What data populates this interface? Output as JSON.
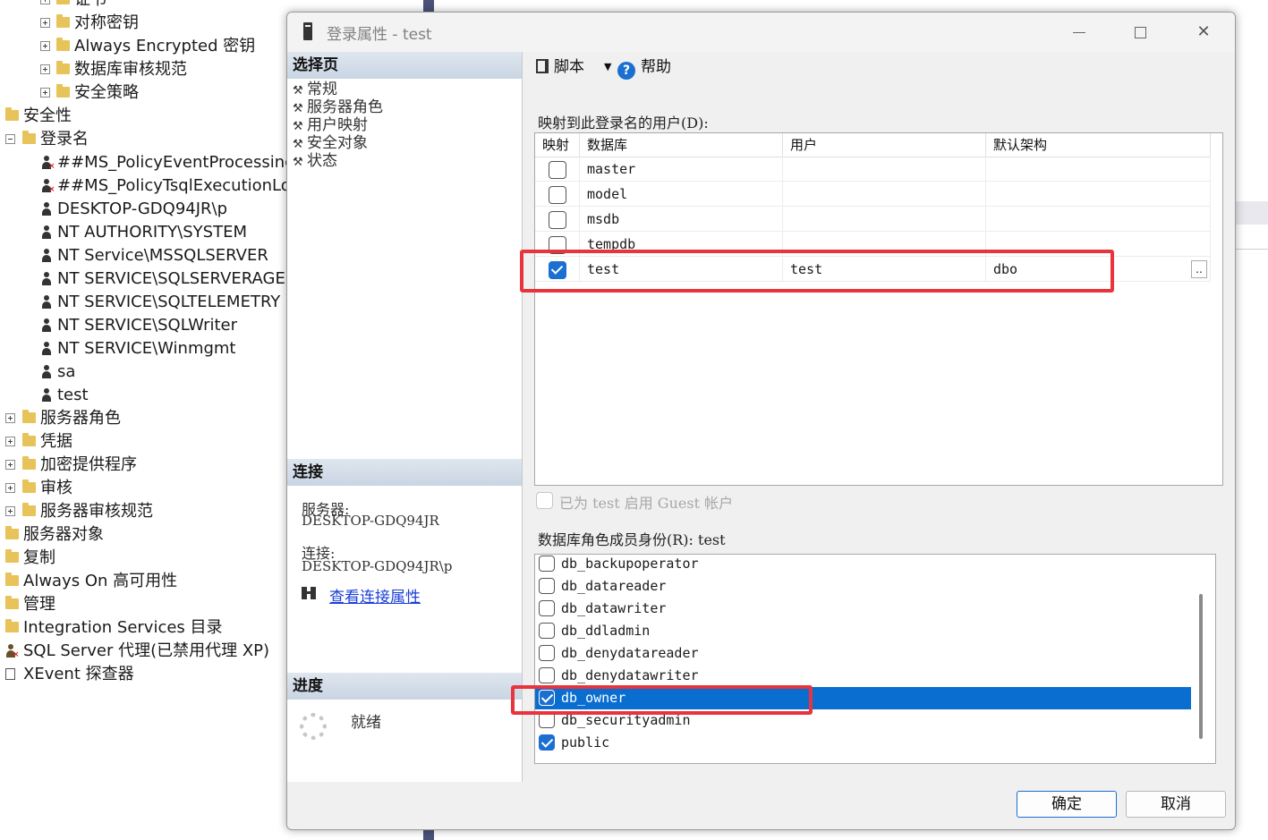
{
  "tree": {
    "items": [
      {
        "label": "证书",
        "depth": 2,
        "icon": "folder-icon",
        "expander": "plus"
      },
      {
        "label": "对称密钥",
        "depth": 2,
        "icon": "folder-icon",
        "expander": "plus"
      },
      {
        "label": "Always Encrypted 密钥",
        "depth": 2,
        "icon": "folder-icon",
        "expander": "plus"
      },
      {
        "label": "数据库审核规范",
        "depth": 2,
        "icon": "folder-icon",
        "expander": "plus"
      },
      {
        "label": "安全策略",
        "depth": 2,
        "icon": "folder-icon",
        "expander": "plus"
      },
      {
        "label": "安全性",
        "depth": 0,
        "icon": "folder-icon",
        "expander": "none"
      },
      {
        "label": "登录名",
        "depth": 1,
        "icon": "folder-icon",
        "expander": "minus"
      },
      {
        "label": "##MS_PolicyEventProcessingLogin##",
        "depth": 2,
        "icon": "login-disabled-icon",
        "expander": "none"
      },
      {
        "label": "##MS_PolicyTsqlExecutionLogin##",
        "depth": 2,
        "icon": "login-disabled-icon",
        "expander": "none"
      },
      {
        "label": "DESKTOP-GDQ94JR\\p",
        "depth": 2,
        "icon": "login-icon",
        "expander": "none"
      },
      {
        "label": "NT AUTHORITY\\SYSTEM",
        "depth": 2,
        "icon": "login-icon",
        "expander": "none"
      },
      {
        "label": "NT Service\\MSSQLSERVER",
        "depth": 2,
        "icon": "login-icon",
        "expander": "none"
      },
      {
        "label": "NT SERVICE\\SQLSERVERAGENT",
        "depth": 2,
        "icon": "login-icon",
        "expander": "none"
      },
      {
        "label": "NT SERVICE\\SQLTELEMETRY",
        "depth": 2,
        "icon": "login-icon",
        "expander": "none"
      },
      {
        "label": "NT SERVICE\\SQLWriter",
        "depth": 2,
        "icon": "login-icon",
        "expander": "none"
      },
      {
        "label": "NT SERVICE\\Winmgmt",
        "depth": 2,
        "icon": "login-icon",
        "expander": "none"
      },
      {
        "label": "sa",
        "depth": 2,
        "icon": "login-icon",
        "expander": "none"
      },
      {
        "label": "test",
        "depth": 2,
        "icon": "login-icon",
        "expander": "none"
      },
      {
        "label": "服务器角色",
        "depth": 1,
        "icon": "folder-icon",
        "expander": "plus"
      },
      {
        "label": "凭据",
        "depth": 1,
        "icon": "folder-icon",
        "expander": "plus"
      },
      {
        "label": "加密提供程序",
        "depth": 1,
        "icon": "folder-icon",
        "expander": "plus"
      },
      {
        "label": "审核",
        "depth": 1,
        "icon": "folder-icon",
        "expander": "plus"
      },
      {
        "label": "服务器审核规范",
        "depth": 1,
        "icon": "folder-icon",
        "expander": "plus"
      },
      {
        "label": "服务器对象",
        "depth": 0,
        "icon": "folder-icon",
        "expander": "none"
      },
      {
        "label": "复制",
        "depth": 0,
        "icon": "folder-icon",
        "expander": "none"
      },
      {
        "label": "Always On 高可用性",
        "depth": 0,
        "icon": "folder-icon",
        "expander": "none"
      },
      {
        "label": "管理",
        "depth": 0,
        "icon": "folder-icon",
        "expander": "none"
      },
      {
        "label": "Integration Services 目录",
        "depth": 0,
        "icon": "folder-icon",
        "expander": "none"
      },
      {
        "label": "SQL Server 代理(已禁用代理 XP)",
        "depth": 0,
        "icon": "agent-disabled-icon",
        "expander": "none"
      },
      {
        "label": "XEvent 探查器",
        "depth": 0,
        "icon": "xevent-icon",
        "expander": "none"
      }
    ]
  },
  "dialog": {
    "title": "登录属性 - test",
    "select_page_header": "选择页",
    "pages": [
      "常规",
      "服务器角色",
      "用户映射",
      "安全对象",
      "状态"
    ],
    "connection_header": "连接",
    "server_label": "服务器:",
    "server_value": "DESKTOP-GDQ94JR",
    "connection_label": "连接:",
    "connection_value": "DESKTOP-GDQ94JR\\p",
    "view_connection_link": "查看连接属性",
    "progress_header": "进度",
    "progress_status": "就绪",
    "toolbar": {
      "script_label": "脚本",
      "help_label": "帮助"
    },
    "mapping_label": "映射到此登录名的用户(D):",
    "mapping_columns": [
      "映射",
      "数据库",
      "用户",
      "默认架构"
    ],
    "mapping_rows": [
      {
        "checked": false,
        "database": "master",
        "user": "",
        "schema": ""
      },
      {
        "checked": false,
        "database": "model",
        "user": "",
        "schema": ""
      },
      {
        "checked": false,
        "database": "msdb",
        "user": "",
        "schema": ""
      },
      {
        "checked": false,
        "database": "tempdb",
        "user": "",
        "schema": ""
      },
      {
        "checked": true,
        "database": "test",
        "user": "test",
        "schema": "dbo"
      }
    ],
    "ellipsis_label": "..",
    "guest_label": "已为 test 启用 Guest 帐户",
    "role_label": "数据库角色成员身份(R): test",
    "roles": [
      {
        "name": "db_backupoperator",
        "checked": false,
        "selected": false
      },
      {
        "name": "db_datareader",
        "checked": false,
        "selected": false
      },
      {
        "name": "db_datawriter",
        "checked": false,
        "selected": false
      },
      {
        "name": "db_ddladmin",
        "checked": false,
        "selected": false
      },
      {
        "name": "db_denydatareader",
        "checked": false,
        "selected": false
      },
      {
        "name": "db_denydatawriter",
        "checked": false,
        "selected": false
      },
      {
        "name": "db_owner",
        "checked": true,
        "selected": true
      },
      {
        "name": "db_securityadmin",
        "checked": false,
        "selected": false
      },
      {
        "name": "public",
        "checked": true,
        "selected": false
      }
    ],
    "ok_label": "确定",
    "cancel_label": "取消"
  },
  "colors": {
    "accent": "#1a6fd0",
    "selection": "#0a6ed1",
    "highlight_box": "#e8343c",
    "link": "#1a3fd6"
  }
}
